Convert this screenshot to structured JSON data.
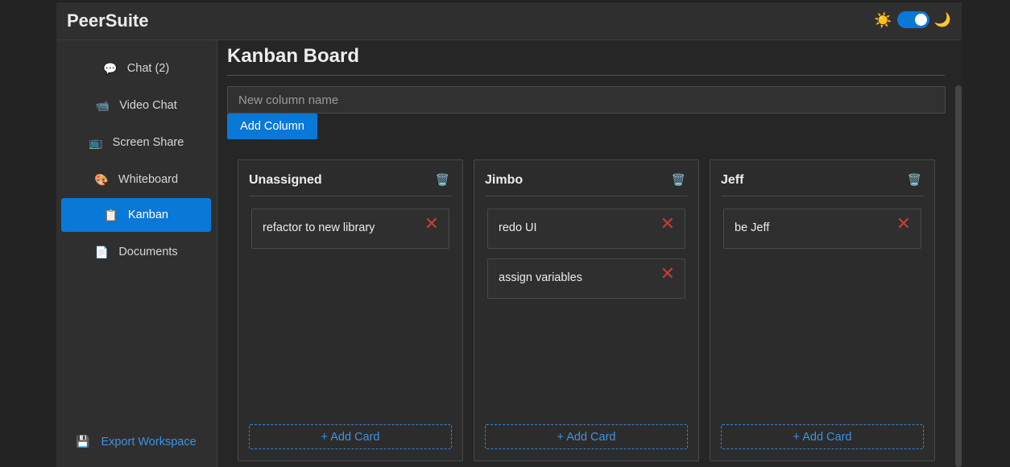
{
  "app": {
    "brand": "PeerSuite"
  },
  "theme": {
    "light_icon": "☀️",
    "dark_icon": "🌙",
    "dark_enabled": true
  },
  "sidebar": {
    "items": [
      {
        "label": "Chat (2)",
        "icon": "💬",
        "active": false
      },
      {
        "label": "Video Chat",
        "icon": "📹",
        "active": false
      },
      {
        "label": "Screen Share",
        "icon": "📺",
        "active": false
      },
      {
        "label": "Whiteboard",
        "icon": "🎨",
        "active": false
      },
      {
        "label": "Kanban",
        "icon": "📋",
        "active": true
      },
      {
        "label": "Documents",
        "icon": "📄",
        "active": false
      }
    ],
    "export": {
      "label": "Export Workspace",
      "icon": "💾"
    }
  },
  "main": {
    "title": "Kanban Board",
    "new_column_placeholder": "New column name",
    "add_column_label": "Add Column",
    "delete_column_icon": "🗑️",
    "delete_card_icon": "✕",
    "add_card_label": "+ Add Card",
    "columns": [
      {
        "title": "Unassigned",
        "cards": [
          "refactor to new library"
        ]
      },
      {
        "title": "Jimbo",
        "cards": [
          "redo UI",
          "assign variables"
        ]
      },
      {
        "title": "Jeff",
        "cards": [
          "be Jeff"
        ]
      }
    ]
  },
  "colors": {
    "accent": "#0a78d7",
    "delete": "#c63b3b",
    "background": "#232323"
  }
}
